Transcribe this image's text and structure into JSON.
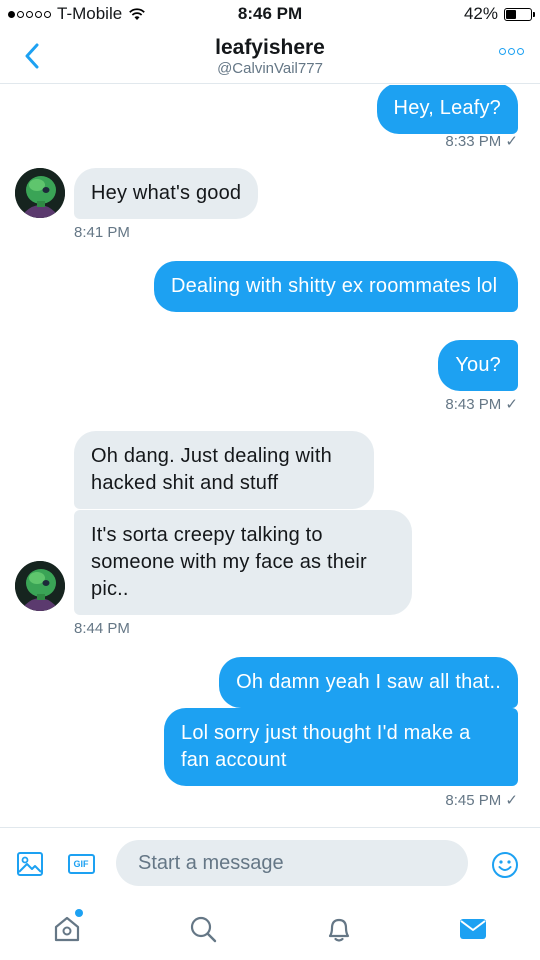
{
  "status_bar": {
    "carrier": "T-Mobile",
    "time": "8:46 PM",
    "battery": "42%",
    "battery_level": 0.42,
    "signal_bars_on": 1,
    "signal_bars_total": 5
  },
  "header": {
    "back_icon": "chevron-left-icon",
    "title": "leafyishere",
    "handle": "@CalvinVail777",
    "more_icon": "more-options-icon"
  },
  "messages": [
    {
      "direction": "out",
      "text": "Hey, Leafy?"
    },
    {
      "direction": "meta-out",
      "text": "8:33 PM ✓"
    },
    {
      "direction": "in",
      "text": "Hey what's good"
    },
    {
      "direction": "meta-in",
      "text": "8:41 PM"
    },
    {
      "direction": "out",
      "text": "Dealing with shitty ex roommates lol"
    },
    {
      "direction": "out",
      "text": "You?"
    },
    {
      "direction": "meta-out",
      "text": "8:43 PM ✓"
    },
    {
      "direction": "in",
      "text": "Oh dang. Just dealing with hacked shit and stuff"
    },
    {
      "direction": "in",
      "text": "It's sorta creepy talking to someone with my face as their pic.."
    },
    {
      "direction": "meta-in",
      "text": "8:44 PM"
    },
    {
      "direction": "out",
      "text": "Oh damn yeah I saw all that.."
    },
    {
      "direction": "out",
      "text": "Lol sorry just thought I'd make a fan account"
    },
    {
      "direction": "meta-out",
      "text": "8:45 PM ✓"
    }
  ],
  "composer": {
    "image_icon": "image-icon",
    "gif_label": "GIF",
    "placeholder": "Start a message",
    "emoji_icon": "smiley-icon"
  },
  "tabbar": {
    "items": [
      "home-icon",
      "search-icon",
      "notifications-bell-icon",
      "messages-envelope-icon"
    ],
    "active": "messages-envelope-icon"
  },
  "colors": {
    "accent": "#1da1f2",
    "incoming_bubble": "#e6ecf0",
    "meta_text": "#657786"
  }
}
